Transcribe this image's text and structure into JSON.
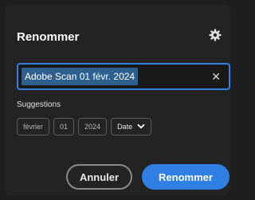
{
  "dialog": {
    "title": "Renommer",
    "settings_icon": "gear-icon"
  },
  "filename": {
    "value": "Adobe Scan 01 févr. 2024",
    "clear_icon": "close-icon",
    "clear_glyph": "✕"
  },
  "suggestions": {
    "label": "Suggestions",
    "chips": [
      "février",
      "01",
      "2024"
    ],
    "select": {
      "value": "Date",
      "icon": "chevron-down-icon",
      "glyph": "❯"
    }
  },
  "actions": {
    "cancel_label": "Annuler",
    "rename_label": "Renommer"
  },
  "colors": {
    "accent": "#2f7fe5",
    "background": "#232323",
    "selection": "#2d5f8f"
  }
}
